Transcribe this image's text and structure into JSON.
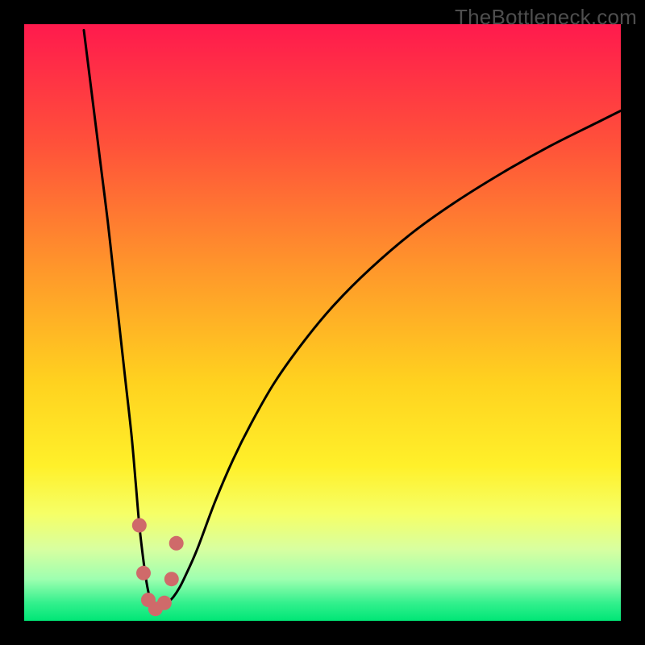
{
  "watermark": {
    "text": "TheBottleneck.com"
  },
  "chart_data": {
    "type": "line",
    "title": "",
    "xlabel": "",
    "ylabel": "",
    "xlim": [
      0,
      100
    ],
    "ylim": [
      0,
      100
    ],
    "optimum_x": 22,
    "note": "V-shaped bottleneck curve on red-to-green vertical gradient; values are pixel-estimated percentages of plot area (x=horizontal position, y=height from bottom).",
    "series": [
      {
        "name": "curve-left",
        "x": [
          10,
          11,
          12,
          13,
          14,
          15,
          16,
          17,
          18,
          18.7,
          19.3,
          20,
          20.5,
          21,
          21.5,
          22
        ],
        "values": [
          99,
          91,
          83,
          75,
          67,
          58,
          49,
          40,
          31,
          23,
          16,
          10,
          6.5,
          4,
          2.5,
          2
        ]
      },
      {
        "name": "curve-right",
        "x": [
          22,
          23,
          24,
          25,
          26,
          27,
          29,
          32,
          35,
          38,
          42,
          47,
          52,
          58,
          65,
          72,
          80,
          88,
          96,
          100
        ],
        "values": [
          2,
          2.3,
          3,
          4,
          5.5,
          7.5,
          12,
          20,
          27,
          33,
          40,
          47,
          53,
          59,
          65,
          70,
          75,
          79.5,
          83.5,
          85.5
        ]
      }
    ],
    "markers": {
      "name": "dots",
      "color": "#cf6a6a",
      "points": [
        {
          "x": 19.3,
          "y": 16
        },
        {
          "x": 20.0,
          "y": 8
        },
        {
          "x": 20.8,
          "y": 3.5
        },
        {
          "x": 22.0,
          "y": 2
        },
        {
          "x": 23.5,
          "y": 3.0
        },
        {
          "x": 24.7,
          "y": 7
        },
        {
          "x": 25.5,
          "y": 13
        }
      ]
    },
    "gradient_stops": [
      {
        "offset": 0.0,
        "color": "#ff1a4d"
      },
      {
        "offset": 0.2,
        "color": "#ff513a"
      },
      {
        "offset": 0.42,
        "color": "#ff9a2a"
      },
      {
        "offset": 0.6,
        "color": "#ffd21f"
      },
      {
        "offset": 0.74,
        "color": "#fff02a"
      },
      {
        "offset": 0.82,
        "color": "#f6ff66"
      },
      {
        "offset": 0.88,
        "color": "#d8ffa0"
      },
      {
        "offset": 0.93,
        "color": "#9effb0"
      },
      {
        "offset": 0.97,
        "color": "#33f08d"
      },
      {
        "offset": 1.0,
        "color": "#00e676"
      }
    ]
  }
}
